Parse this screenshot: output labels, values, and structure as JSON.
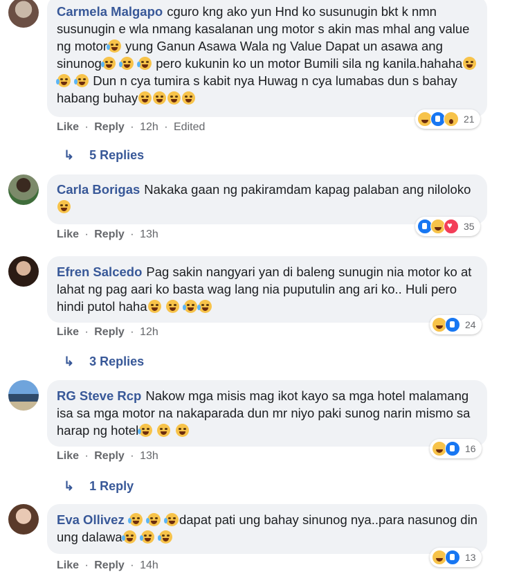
{
  "comments": [
    {
      "author": "Carmela Malgapo",
      "segments": [
        "cguro kng ako yun Hnd ko susunugin bkt k nmn susunugin e wla nmang kasalanan ung motor s akin mas mhal ang value ng motor",
        " yung Ganun Asawa Wala ng Value Dapat un asawa ang sinunog",
        " pero kukunin ko un motor Bumili sila ng kanila.hahaha",
        " Dun n cya tumira s kabit nya Huwag n cya lumabas dun s bahay habang buhay"
      ],
      "like": "Like",
      "reply": "Reply",
      "time": "12h",
      "edited": "Edited",
      "reaction_count": "21",
      "replies": "5 Replies"
    },
    {
      "author": "Carla Borigas",
      "segments": [
        "Nakaka gaan ng pakiramdam kapag palaban ang niloloko"
      ],
      "like": "Like",
      "reply": "Reply",
      "time": "13h",
      "reaction_count": "35"
    },
    {
      "author": "Efren Salcedo",
      "segments": [
        "Pag sakin nangyari yan di baleng sunugin nia motor ko at lahat ng pag aari ko basta wag lang nia puputulin ang ari ko.. Huli pero hindi putol haha"
      ],
      "like": "Like",
      "reply": "Reply",
      "time": "12h",
      "reaction_count": "24",
      "replies": "3 Replies"
    },
    {
      "author": "RG Steve Rcp",
      "segments": [
        "Nakow mga misis mag ikot kayo sa mga hotel malamang isa sa mga motor na nakaparada dun mr niyo paki sunog narin mismo sa harap ng hotel"
      ],
      "like": "Like",
      "reply": "Reply",
      "time": "13h",
      "reaction_count": "16",
      "replies": "1 Reply"
    },
    {
      "author": "Eva Ollivez",
      "segments": [
        "",
        "dapat pati ung bahay sinunog nya..para nasunog din ung dalawa"
      ],
      "like": "Like",
      "reply": "Reply",
      "time": "14h",
      "reaction_count": "13"
    }
  ],
  "separator": "·",
  "reply_arrow": "↳"
}
